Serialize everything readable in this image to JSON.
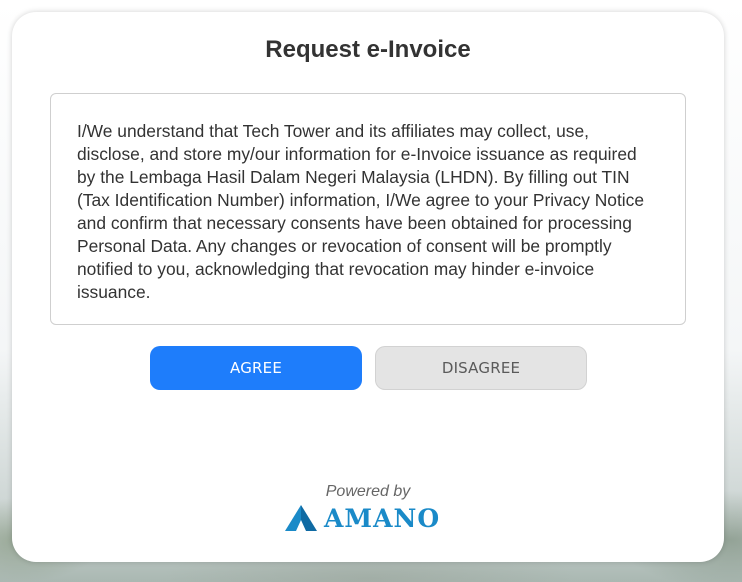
{
  "dialog": {
    "title": "Request e-Invoice",
    "consent_text": "I/We understand that Tech Tower and its affiliates may collect, use, disclose, and store my/our information for e-Invoice issuance as required by the Lembaga Hasil Dalam Negeri Malaysia (LHDN). By filling out TIN (Tax Identification Number) information, I/We agree to your Privacy Notice and confirm that necessary consents have been obtained for processing Personal Data. Any changes or revocation of consent will be promptly notified to you, acknowledging that revocation may hinder e-invoice issuance.",
    "agree_label": "AGREE",
    "disagree_label": "DISAGREE"
  },
  "footer": {
    "powered_by": "Powered by",
    "brand_name": "AMANO",
    "brand_icon": "amano-logo-icon"
  },
  "colors": {
    "accent": "#1e7dfb",
    "brand": "#1a8ac8",
    "disagree_bg": "#e4e4e4"
  }
}
